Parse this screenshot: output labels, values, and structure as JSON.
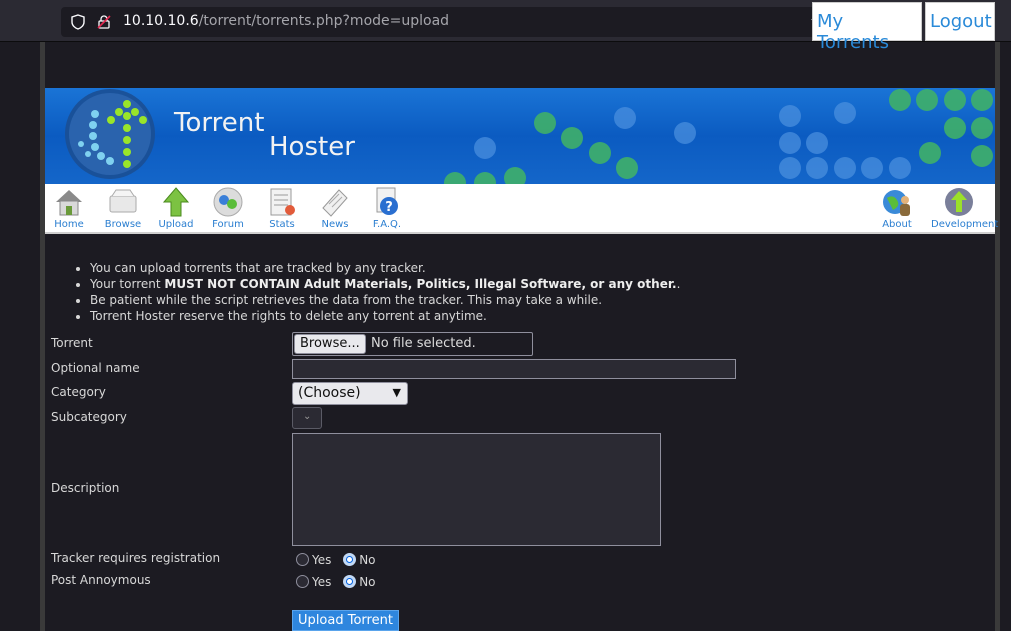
{
  "browser": {
    "url_host": "10.10.10.6",
    "url_path": "/torrent/torrents.php?mode=upload"
  },
  "toplinks": {
    "my_torrents": "My Torrents",
    "logout": "Logout"
  },
  "banner": {
    "title_line1": "Torrent",
    "title_line2": "Hoster"
  },
  "nav": {
    "items": [
      {
        "label": "Home",
        "icon": "home-icon"
      },
      {
        "label": "Browse",
        "icon": "browse-icon"
      },
      {
        "label": "Upload",
        "icon": "upload-icon"
      },
      {
        "label": "Forum",
        "icon": "forum-icon"
      },
      {
        "label": "Stats",
        "icon": "stats-icon"
      },
      {
        "label": "News",
        "icon": "news-icon"
      },
      {
        "label": "F.A.Q.",
        "icon": "faq-icon"
      }
    ],
    "right_items": [
      {
        "label": "About",
        "icon": "about-icon"
      },
      {
        "label": "Development",
        "icon": "development-icon"
      }
    ]
  },
  "notes": {
    "n1": "You can upload torrents that are tracked by any tracker.",
    "n2_pre": "Your torrent ",
    "n2_bold": "MUST NOT CONTAIN Adult Materials, Politics, Illegal Software, or any other.",
    "n2_post": ".",
    "n3": "Be patient while the script retrieves the data from the tracker. This may take a while.",
    "n4": "Torrent Hoster reserve the rights to delete any torrent at anytime."
  },
  "form": {
    "torrent_label": "Torrent",
    "browse_button": "Browse...",
    "file_status": "No file selected.",
    "optional_name_label": "Optional name",
    "optional_name_value": "",
    "category_label": "Category",
    "category_selected": "(Choose)",
    "subcategory_label": "Subcategory",
    "description_label": "Description",
    "tracker_label": "Tracker requires registration",
    "post_anon_label": "Post Annoymous",
    "yes": "Yes",
    "no": "No",
    "submit": "Upload Torrent"
  },
  "colors": {
    "link": "#2a8ad8",
    "banner": "#0b5bc1",
    "submit": "#2e86de"
  }
}
